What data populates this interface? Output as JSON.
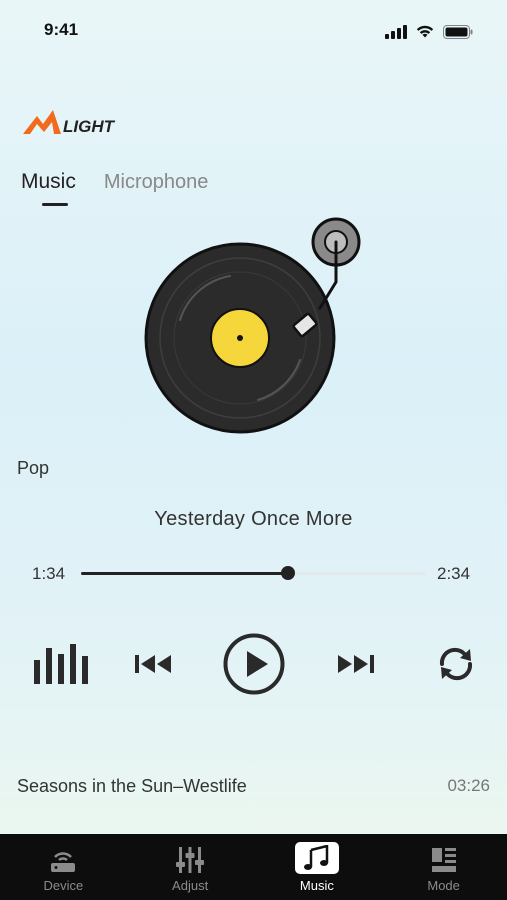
{
  "status": {
    "time": "9:41"
  },
  "brand": {
    "logo_text": "LIGHT"
  },
  "tabs": [
    {
      "label": "Music"
    },
    {
      "label": "Microphone"
    }
  ],
  "player": {
    "genre": "Pop",
    "song_title": "Yesterday Once More",
    "current_time": "1:34",
    "total_time": "2:34",
    "progress": 0.6
  },
  "controls": [
    "equalizer-icon",
    "previous-icon",
    "play-icon",
    "next-icon",
    "repeat-icon"
  ],
  "playlist": [
    {
      "title": "Seasons in the Sun–Westlife",
      "duration": "03:26"
    }
  ],
  "bottom_nav": {
    "items": [
      {
        "label": "Device"
      },
      {
        "label": "Adjust"
      },
      {
        "label": "Music"
      },
      {
        "label": "Mode"
      }
    ],
    "active": "Music"
  },
  "colors": {
    "accent_orange": "#f26a1b",
    "record_label": "#f5d63b",
    "record_body": "#2b2b2b"
  }
}
